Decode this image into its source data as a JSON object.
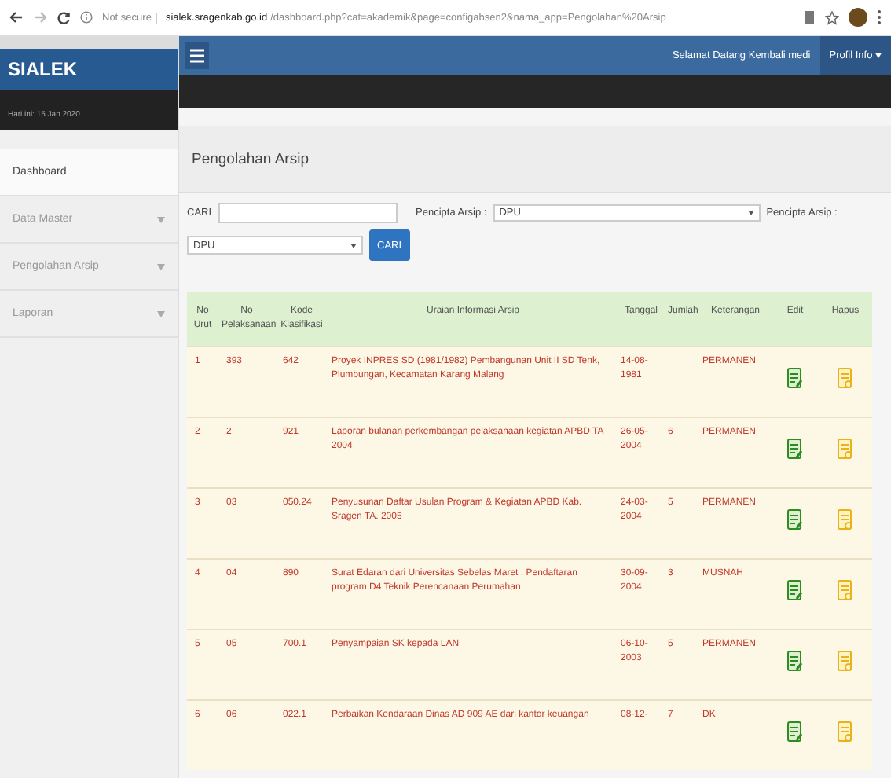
{
  "browser": {
    "security": "Not secure",
    "url_host": "sialek.sragenkab.go.id",
    "url_path": "/dashboard.php?cat=akademik&page=configabsen2&nama_app=Pengolahan%20Arsip"
  },
  "brand": "SIALEK",
  "date": "Hari ini: 15 Jan 2020",
  "topbar": {
    "welcome": "Selamat Datang Kembali medi",
    "profile": "Profil Info"
  },
  "sidebar": {
    "items": [
      {
        "label": "Dashboard",
        "selected": true,
        "has_caret": false
      },
      {
        "label": "Data Master",
        "selected": false,
        "has_caret": true
      },
      {
        "label": "Pengolahan Arsip",
        "selected": false,
        "has_caret": true
      },
      {
        "label": "Laporan",
        "selected": false,
        "has_caret": true
      }
    ]
  },
  "page_title": "Pengolahan Arsip",
  "search": {
    "label": "CARI",
    "pencipta_label": "Pencipta Arsip :",
    "pencipta_value": "DPU",
    "pencipta_label_2": "Pencipta Arsip :",
    "select_value": "DPU",
    "button": "CARI"
  },
  "table": {
    "columns": [
      "No Urut",
      "No Pelaksanaan",
      "Kode Klasifikasi",
      "Uraian Informasi Arsip",
      "Tanggal",
      "Jumlah",
      "Keterangan",
      "Edit",
      "Hapus"
    ],
    "rows": [
      {
        "no": "1",
        "pelaksanaan": "393",
        "kode": "642",
        "uraian": "Proyek INPRES SD (1981/1982) Pembangunan Unit II SD Tenk, Plumbungan, Kecamatan Karang Malang",
        "tanggal": "14-08-1981",
        "jumlah": "",
        "keterangan": "PERMANEN"
      },
      {
        "no": "2",
        "pelaksanaan": "2",
        "kode": "921",
        "uraian": "Laporan bulanan perkembangan pelaksanaan kegiatan APBD TA 2004",
        "tanggal": "26-05-2004",
        "jumlah": "6",
        "keterangan": "PERMANEN"
      },
      {
        "no": "3",
        "pelaksanaan": "03",
        "kode": "050.24",
        "uraian": "Penyusunan Daftar Usulan Program & Kegiatan APBD Kab. Sragen TA. 2005",
        "tanggal": "24-03-2004",
        "jumlah": "5",
        "keterangan": "PERMANEN"
      },
      {
        "no": "4",
        "pelaksanaan": "04",
        "kode": "890",
        "uraian": "Surat Edaran dari Universitas Sebelas Maret , Pendaftaran program D4 Teknik Perencanaan Perumahan",
        "tanggal": "30-09-2004",
        "jumlah": "3",
        "keterangan": "MUSNAH"
      },
      {
        "no": "5",
        "pelaksanaan": "05",
        "kode": "700.1",
        "uraian": "Penyampaian SK kepada LAN",
        "tanggal": "06-10-2003",
        "jumlah": "5",
        "keterangan": "PERMANEN"
      },
      {
        "no": "6",
        "pelaksanaan": "06",
        "kode": "022.1",
        "uraian": "Perbaikan Kendaraan Dinas AD 909 AE dari kantor keuangan",
        "tanggal": "08-12-",
        "jumlah": "7",
        "keterangan": "DK"
      }
    ]
  }
}
